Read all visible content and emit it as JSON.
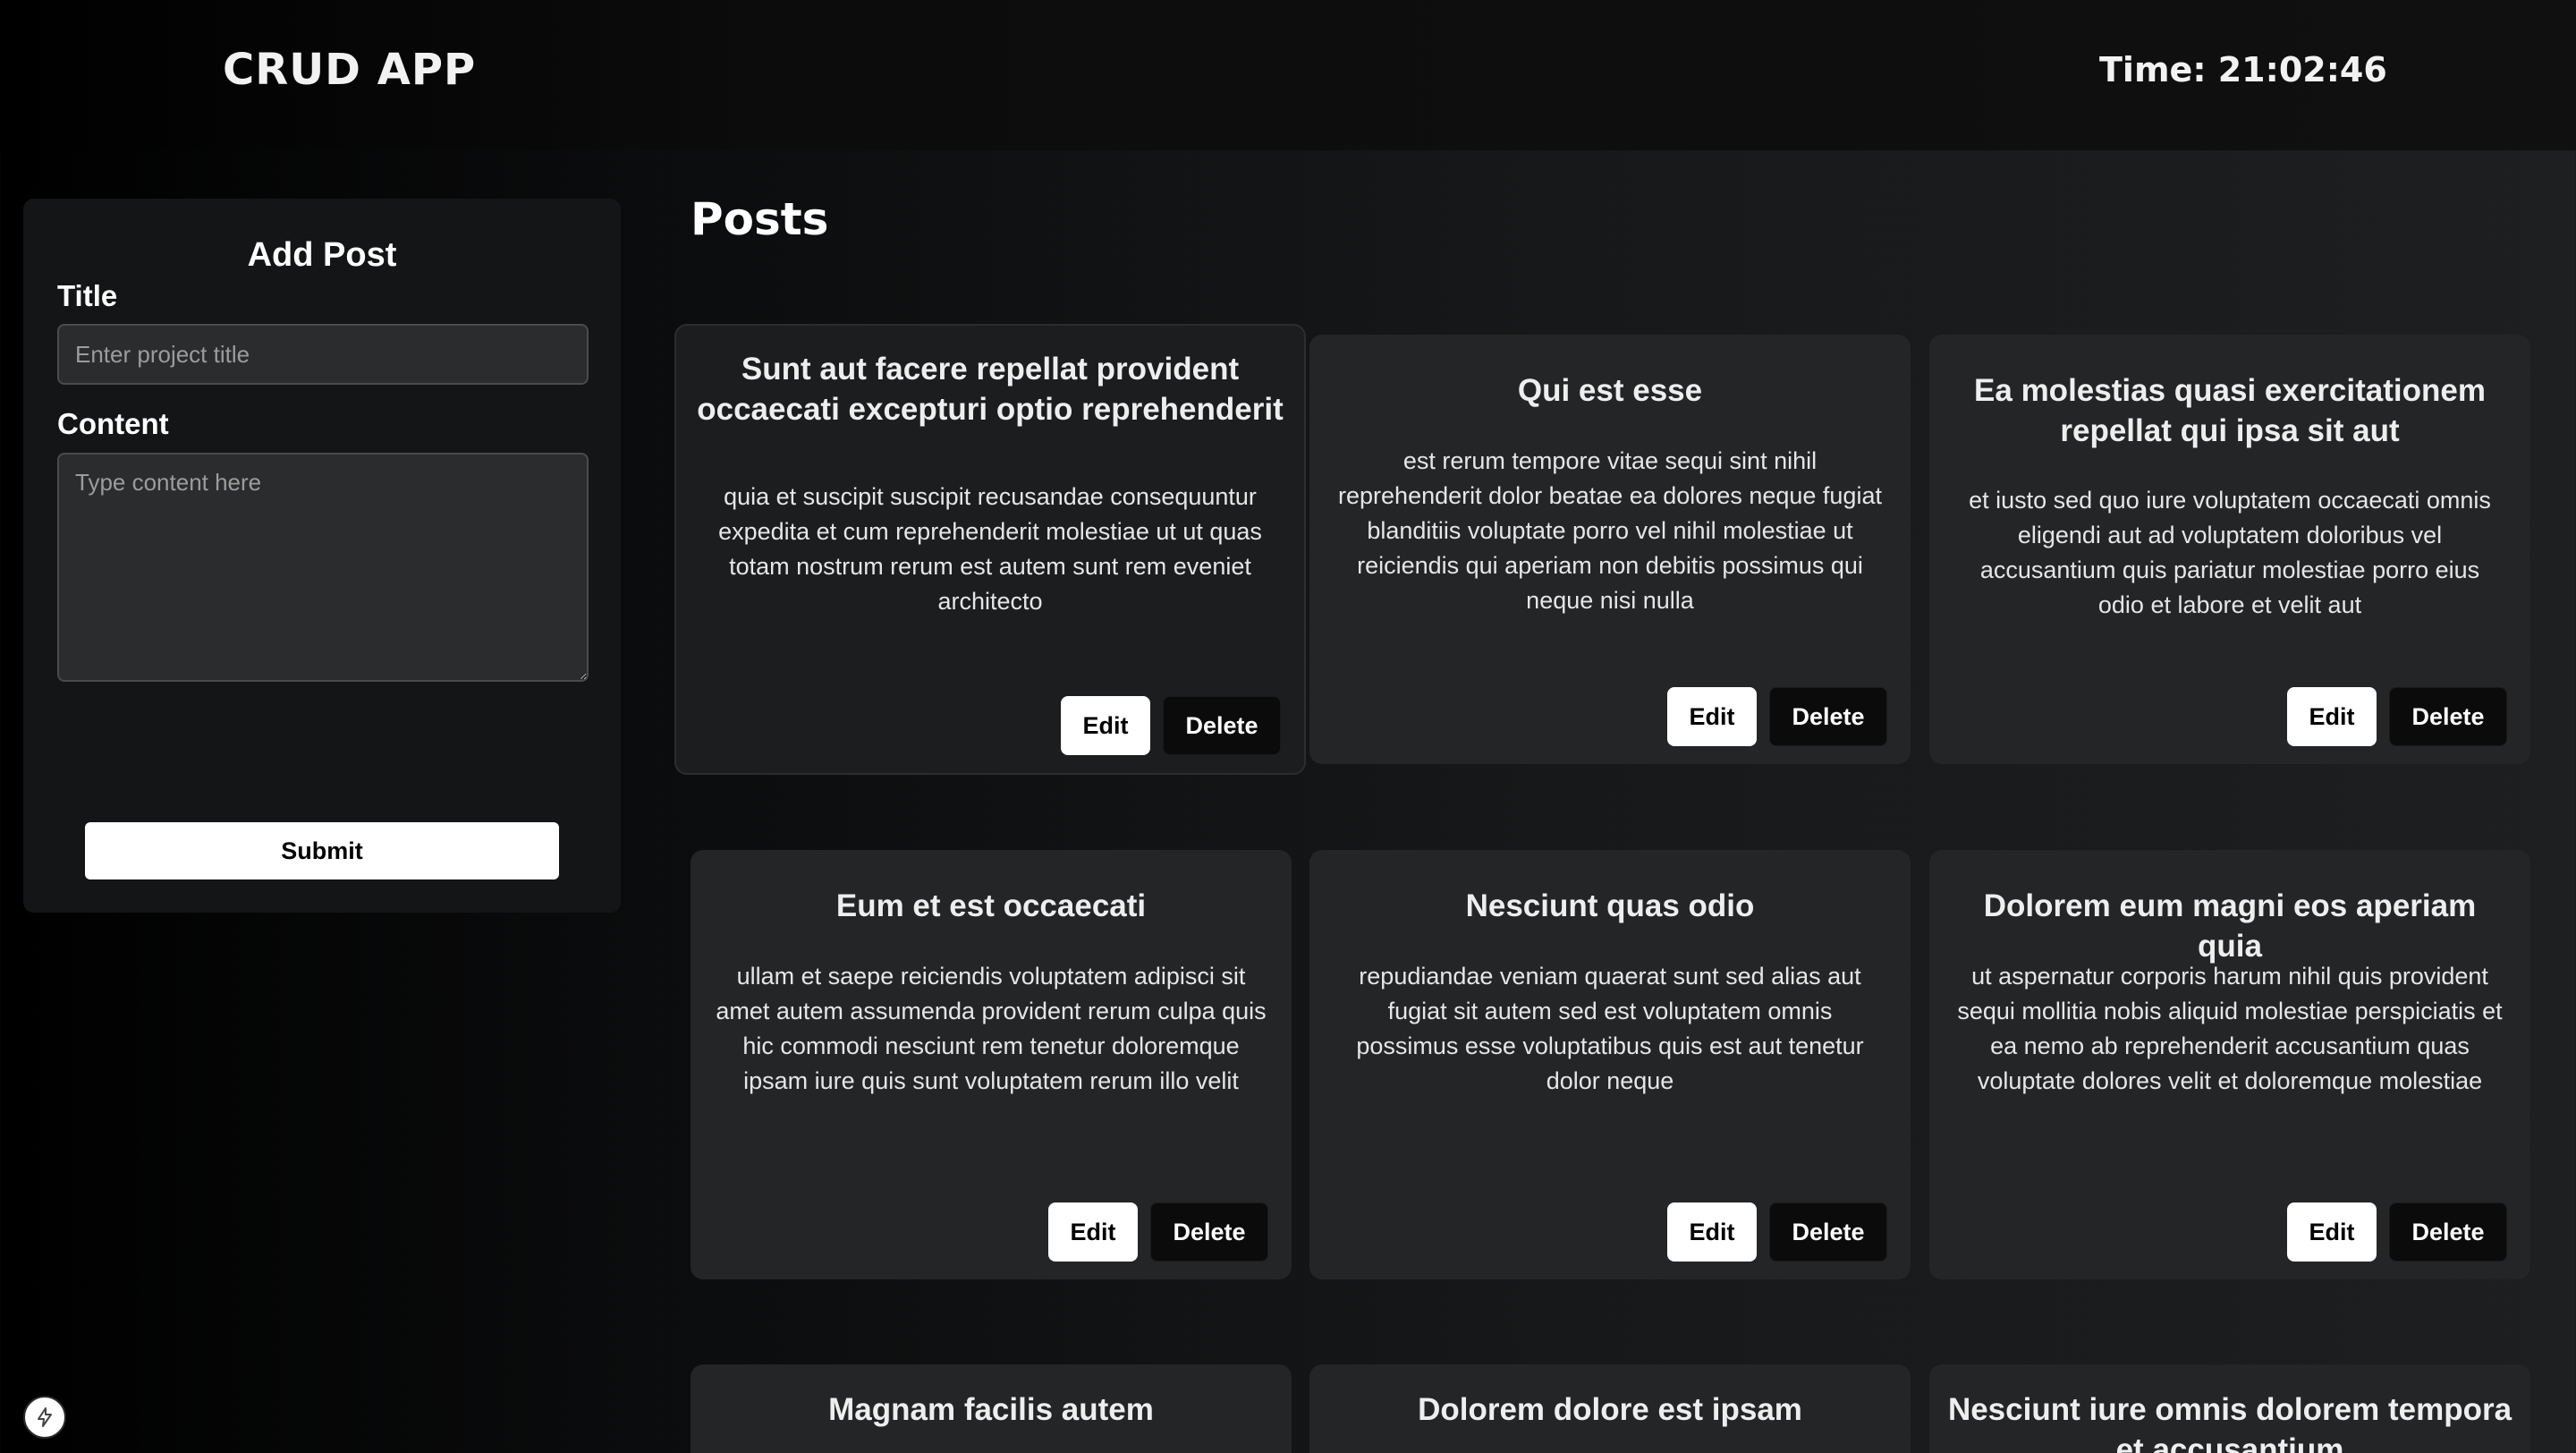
{
  "header": {
    "brand": "CRUD APP",
    "clock": "Time: 21:02:46"
  },
  "form": {
    "heading": "Add Post",
    "title_label": "Title",
    "title_placeholder": "Enter project title",
    "title_value": "",
    "content_label": "Content",
    "content_placeholder": "Type content here",
    "content_value": "",
    "submit_label": "Submit"
  },
  "posts": {
    "heading": "Posts",
    "edit_label": "Edit",
    "delete_label": "Delete",
    "items": [
      {
        "title": "Sunt aut facere repellat provident occaecati excepturi optio reprehenderit",
        "body": "quia et suscipit suscipit recusandae consequuntur expedita et cum reprehenderit molestiae ut ut quas totam nostrum rerum est autem sunt rem eveniet architecto"
      },
      {
        "title": "Qui est esse",
        "body": "est rerum tempore vitae sequi sint nihil reprehenderit dolor beatae ea dolores neque fugiat blanditiis voluptate porro vel nihil molestiae ut reiciendis qui aperiam non debitis possimus qui neque nisi nulla"
      },
      {
        "title": "Ea molestias quasi exercitationem repellat qui ipsa sit aut",
        "body": "et iusto sed quo iure voluptatem occaecati omnis eligendi aut ad voluptatem doloribus vel accusantium quis pariatur molestiae porro eius odio et labore et velit aut"
      },
      {
        "title": "Eum et est occaecati",
        "body": "ullam et saepe reiciendis voluptatem adipisci sit amet autem assumenda provident rerum culpa quis hic commodi nesciunt rem tenetur doloremque ipsam iure quis sunt voluptatem rerum illo velit"
      },
      {
        "title": "Nesciunt quas odio",
        "body": "repudiandae veniam quaerat sunt sed alias aut fugiat sit autem sed est voluptatem omnis possimus esse voluptatibus quis est aut tenetur dolor neque"
      },
      {
        "title": "Dolorem eum magni eos aperiam quia",
        "body": "ut aspernatur corporis harum nihil quis provident sequi mollitia nobis aliquid molestiae perspiciatis et ea nemo ab reprehenderit accusantium quas voluptate dolores velit et doloremque molestiae"
      },
      {
        "title": "Magnam facilis autem"
      },
      {
        "title": "Dolorem dolore est ipsam"
      },
      {
        "title": "Nesciunt iure omnis dolorem tempora et accusantium"
      }
    ]
  },
  "icons": {
    "dev_indicator": "lightning-icon"
  }
}
